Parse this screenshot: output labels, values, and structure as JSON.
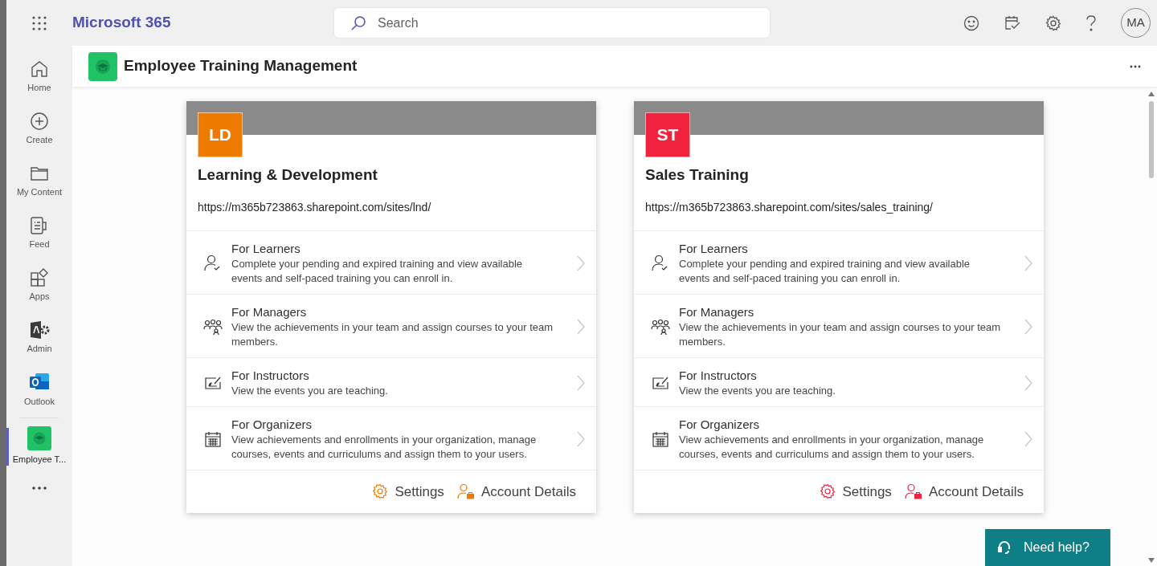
{
  "app_bar": {
    "brand": "Microsoft 365",
    "search": {
      "placeholder": "Search"
    },
    "avatar": "MA"
  },
  "rail": {
    "items": [
      {
        "kind": "home",
        "label": "Home",
        "selected": false
      },
      {
        "kind": "create",
        "label": "Create",
        "selected": false
      },
      {
        "kind": "content",
        "label": "My Content",
        "selected": false
      },
      {
        "kind": "feed",
        "label": "Feed",
        "selected": false
      },
      {
        "kind": "apps",
        "label": "Apps",
        "selected": false
      },
      {
        "kind": "admin",
        "label": "Admin",
        "selected": false
      },
      {
        "kind": "outlook",
        "label": "Outlook",
        "selected": false
      },
      {
        "kind": "training",
        "label": "Employee T...",
        "selected": true
      }
    ]
  },
  "app_header": {
    "title": "Employee Training Management"
  },
  "sites": [
    {
      "initials": "LD",
      "color": "#ee7a00",
      "title": "Learning & Development",
      "url": "https://m365b723863.sharepoint.com/sites/lnd/",
      "links": [
        {
          "kind": "learners",
          "title": "For Learners",
          "description": "Complete your pending and expired training and view available events and self-paced training you can enroll in."
        },
        {
          "kind": "managers",
          "title": "For Managers",
          "description": "View the achievements in your team and assign courses to your team members."
        },
        {
          "kind": "instructors",
          "title": "For Instructors",
          "description": "View the events you are teaching."
        },
        {
          "kind": "organizers",
          "title": "For Organizers",
          "description": "View achievements and enrollments in your organization, manage courses, events and curriculums and assign them to your users."
        }
      ],
      "footer": [
        {
          "kind": "settings",
          "label": "Settings"
        },
        {
          "kind": "account",
          "label": "Account Details"
        }
      ]
    },
    {
      "initials": "ST",
      "color": "#f0223d",
      "title": "Sales Training",
      "url": "https://m365b723863.sharepoint.com/sites/sales_training/",
      "links": [
        {
          "kind": "learners",
          "title": "For Learners",
          "description": "Complete your pending and expired training and view available events and self-paced training you can enroll in."
        },
        {
          "kind": "managers",
          "title": "For Managers",
          "description": "View the achievements in your team and assign courses to your team members."
        },
        {
          "kind": "instructors",
          "title": "For Instructors",
          "description": "View the events you are teaching."
        },
        {
          "kind": "organizers",
          "title": "For Organizers",
          "description": "View achievements and enrollments in your organization, manage courses, events and curriculums and assign them to your users."
        }
      ],
      "footer": [
        {
          "kind": "settings",
          "label": "Settings"
        },
        {
          "kind": "account",
          "label": "Account Details"
        }
      ]
    }
  ],
  "help_button": {
    "label": "Need help?"
  }
}
